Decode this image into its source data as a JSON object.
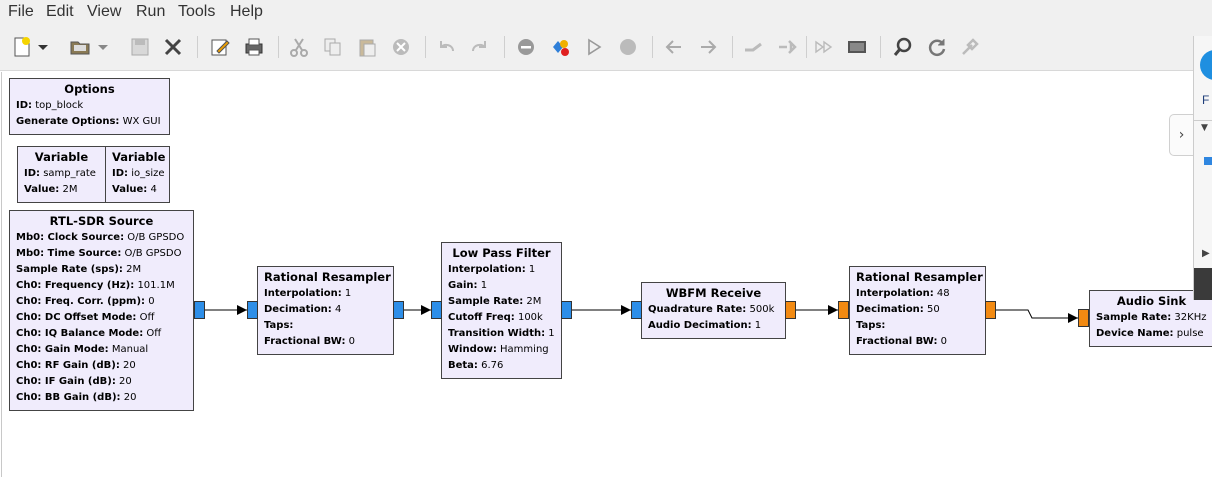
{
  "menu": [
    "File",
    "Edit",
    "View",
    "Run",
    "Tools",
    "Help"
  ],
  "toolbar_icons": [
    "new-file",
    "dropdown",
    "open-folder",
    "dropdown",
    "save",
    "close",
    "edit-properties",
    "print",
    "cut",
    "copy",
    "paste",
    "delete",
    "undo",
    "redo",
    "disable",
    "kill",
    "execute",
    "stop",
    "rotate-left",
    "rotate-right",
    "enable",
    "bypass",
    "forward",
    "screenshot",
    "find",
    "reload",
    "tools"
  ],
  "blocks": {
    "options": {
      "title": "Options",
      "params": [
        {
          "k": "ID:",
          "v": "top_block"
        },
        {
          "k": "Generate Options:",
          "v": "WX GUI"
        }
      ]
    },
    "var1": {
      "title": "Variable",
      "params": [
        {
          "k": "ID:",
          "v": "samp_rate"
        },
        {
          "k": "Value:",
          "v": "2M"
        }
      ]
    },
    "var2": {
      "title": "Variable",
      "params": [
        {
          "k": "ID:",
          "v": "io_size"
        },
        {
          "k": "Value:",
          "v": "4"
        }
      ]
    },
    "rtl": {
      "title": "RTL-SDR Source",
      "params": [
        {
          "k": "Mb0: Clock Source:",
          "v": "O/B GPSDO"
        },
        {
          "k": "Mb0: Time Source:",
          "v": "O/B GPSDO"
        },
        {
          "k": "Sample Rate (sps):",
          "v": "2M"
        },
        {
          "k": "Ch0: Frequency (Hz):",
          "v": "101.1M"
        },
        {
          "k": "Ch0: Freq. Corr. (ppm):",
          "v": "0"
        },
        {
          "k": "Ch0: DC Offset Mode:",
          "v": "Off"
        },
        {
          "k": "Ch0: IQ Balance Mode:",
          "v": "Off"
        },
        {
          "k": "Ch0: Gain Mode:",
          "v": "Manual"
        },
        {
          "k": "Ch0: RF Gain (dB):",
          "v": "20"
        },
        {
          "k": "Ch0: IF Gain (dB):",
          "v": "20"
        },
        {
          "k": "Ch0: BB Gain (dB):",
          "v": "20"
        }
      ]
    },
    "rr1": {
      "title": "Rational Resampler",
      "params": [
        {
          "k": "Interpolation:",
          "v": "1"
        },
        {
          "k": "Decimation:",
          "v": "4"
        },
        {
          "k": "Taps:",
          "v": ""
        },
        {
          "k": "Fractional BW:",
          "v": "0"
        }
      ]
    },
    "lpf": {
      "title": "Low Pass Filter",
      "params": [
        {
          "k": "Interpolation:",
          "v": "1"
        },
        {
          "k": "Gain:",
          "v": "1"
        },
        {
          "k": "Sample Rate:",
          "v": "2M"
        },
        {
          "k": "Cutoff Freq:",
          "v": "100k"
        },
        {
          "k": "Transition Width:",
          "v": "1"
        },
        {
          "k": "Window:",
          "v": "Hamming"
        },
        {
          "k": "Beta:",
          "v": "6.76"
        }
      ]
    },
    "wbfm": {
      "title": "WBFM Receive",
      "params": [
        {
          "k": "Quadrature Rate:",
          "v": "500k"
        },
        {
          "k": "Audio Decimation:",
          "v": "1"
        }
      ]
    },
    "rr2": {
      "title": "Rational Resampler",
      "params": [
        {
          "k": "Interpolation:",
          "v": "48"
        },
        {
          "k": "Decimation:",
          "v": "50"
        },
        {
          "k": "Taps:",
          "v": ""
        },
        {
          "k": "Fractional BW:",
          "v": "0"
        }
      ]
    },
    "sink": {
      "title": "Audio Sink",
      "params": [
        {
          "k": "Sample Rate:",
          "v": "32KHz"
        },
        {
          "k": "Device Name:",
          "v": "pulse"
        }
      ]
    }
  },
  "side_panel": {
    "label": "F",
    "accent": "#1f8fe0"
  },
  "colors": {
    "block_bg": "#f0ecfc",
    "port_complex": "#2d8ee8",
    "port_float": "#f28a12"
  }
}
